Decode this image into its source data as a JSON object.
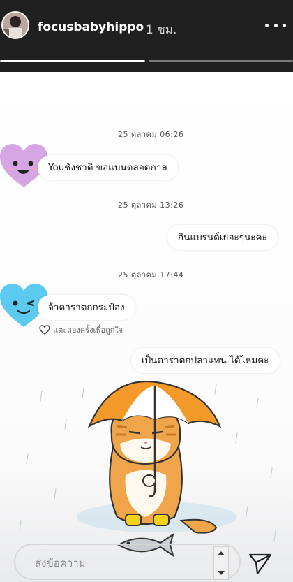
{
  "header": {
    "username": "focusbabyhippo",
    "time_ago": "1 ชม."
  },
  "story_progress": [
    1.0,
    0.0
  ],
  "chat": {
    "timestamps": [
      "25 ตุลาคม 06:26",
      "25 ตุลาคม 13:26",
      "25 ตุลาคม 17:44"
    ],
    "messages": [
      {
        "side": "left",
        "text": "Youชังชาติ ขอแบนตลอดกาล",
        "avatar": "purple-heart-face-icon"
      },
      {
        "side": "right",
        "text": "กินแบรนด์เยอะๆนะคะ"
      },
      {
        "side": "left",
        "text": "จ้าดาราตกกระป๋อง",
        "avatar": "blue-heart-face-icon"
      },
      {
        "side": "right",
        "text": "เป็นดาราตกปลาแทน ได้ไหมคะ"
      }
    ],
    "like_hint": "แตะสองครั้งเพื่อถูกใจ"
  },
  "composer": {
    "placeholder": "ส่งข้อความ"
  },
  "colors": {
    "header_bg": "#202020",
    "purple_heart": "#d6a6e4",
    "blue_heart": "#5ccaf0"
  }
}
